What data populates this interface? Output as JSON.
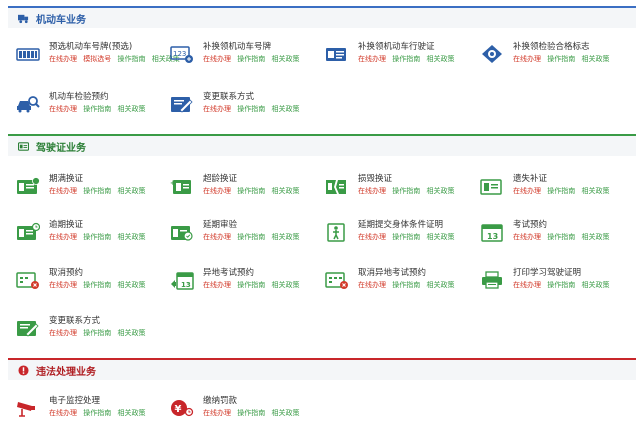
{
  "sections": [
    {
      "title": "机动车业务",
      "items": [
        {
          "icon": "license-plate-icon",
          "title": "预选机动车号牌(预选)",
          "links": [
            "在线办理",
            "模拟选号",
            "操作指南",
            "相关政策"
          ]
        },
        {
          "icon": "plate-replace-icon",
          "title": "补换领机动车号牌",
          "links": [
            "在线办理",
            "操作指南",
            "相关政策"
          ]
        },
        {
          "icon": "vehicle-license-icon",
          "title": "补换领机动车行驶证",
          "links": [
            "在线办理",
            "操作指南",
            "相关政策"
          ]
        },
        {
          "icon": "inspection-badge-icon",
          "title": "补换领检验合格标志",
          "links": [
            "在线办理",
            "操作指南",
            "相关政策"
          ]
        },
        {
          "icon": "car-search-icon",
          "title": "机动车检验预约",
          "links": [
            "在线办理",
            "操作指南",
            "相关政策"
          ]
        },
        {
          "icon": "contact-change-icon",
          "title": "变更联系方式",
          "links": [
            "在线办理",
            "操作指南",
            "相关政策"
          ]
        }
      ]
    },
    {
      "title": "驾驶证业务",
      "items": [
        {
          "icon": "id-card-renew-icon",
          "title": "期满换证",
          "links": [
            "在线办理",
            "操作指南",
            "相关政策"
          ]
        },
        {
          "icon": "age-renew-icon",
          "title": "超龄换证",
          "links": [
            "在线办理",
            "操作指南",
            "相关政策"
          ]
        },
        {
          "icon": "damaged-card-icon",
          "title": "损毁换证",
          "links": [
            "在线办理",
            "操作指南",
            "相关政策"
          ]
        },
        {
          "icon": "lost-card-icon",
          "title": "遗失补证",
          "links": [
            "在线办理",
            "操作指南",
            "相关政策"
          ]
        },
        {
          "icon": "overdue-card-icon",
          "title": "逾期换证",
          "links": [
            "在线办理",
            "操作指南",
            "相关政策"
          ]
        },
        {
          "icon": "extend-review-icon",
          "title": "延期审验",
          "links": [
            "在线办理",
            "操作指南",
            "相关政策"
          ]
        },
        {
          "icon": "health-proof-icon",
          "title": "延期提交身体条件证明",
          "links": [
            "在线办理",
            "操作指南",
            "相关政策"
          ]
        },
        {
          "icon": "exam-calendar-icon",
          "title": "考试预约",
          "links": [
            "在线办理",
            "操作指南",
            "相关政策"
          ]
        },
        {
          "icon": "cancel-booking-icon",
          "title": "取消预约",
          "links": [
            "在线办理",
            "操作指南",
            "相关政策"
          ]
        },
        {
          "icon": "remote-exam-icon",
          "title": "异地考试预约",
          "links": [
            "在线办理",
            "操作指南",
            "相关政策"
          ]
        },
        {
          "icon": "cancel-remote-icon",
          "title": "取消异地考试预约",
          "links": [
            "在线办理",
            "操作指南",
            "相关政策"
          ]
        },
        {
          "icon": "printer-icon",
          "title": "打印学习驾驶证明",
          "links": [
            "在线办理",
            "操作指南",
            "相关政策"
          ]
        },
        {
          "icon": "contact-change-icon",
          "title": "变更联系方式",
          "links": [
            "在线办理",
            "操作指南",
            "相关政策"
          ]
        }
      ]
    },
    {
      "title": "违法处理业务",
      "items": [
        {
          "icon": "camera-monitor-icon",
          "title": "电子监控处理",
          "links": [
            "在线办理",
            "操作指南",
            "相关政策"
          ]
        },
        {
          "icon": "fine-payment-icon",
          "title": "缴纳罚款",
          "links": [
            "在线办理",
            "操作指南",
            "相关政策"
          ]
        }
      ]
    }
  ],
  "colors": {
    "blue": "#2d5fa8",
    "green": "#3a9b46",
    "red": "#c8262a",
    "online_link": "#d23a2a"
  }
}
